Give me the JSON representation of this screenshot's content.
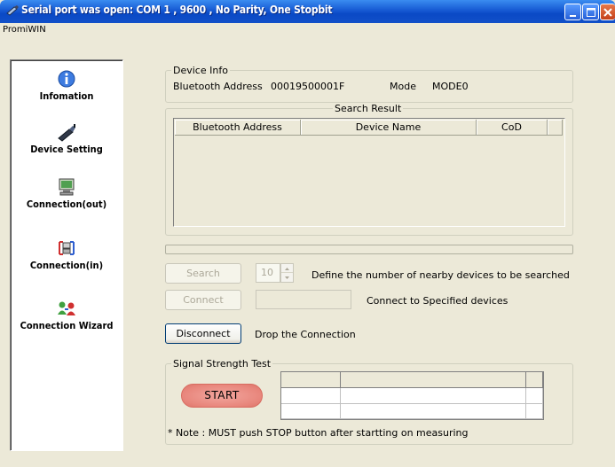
{
  "window": {
    "title": "Serial port was open: COM 1 , 9600 , No Parity, One Stopbit",
    "app_name": "PromiWIN"
  },
  "sidebar": {
    "items": [
      {
        "label": "Infomation",
        "icon": "info-icon"
      },
      {
        "label": "Device Setting",
        "icon": "device-setting-icon"
      },
      {
        "label": "Connection(out)",
        "icon": "connection-out-icon"
      },
      {
        "label": "Connection(in)",
        "icon": "connection-in-icon"
      },
      {
        "label": "Connection Wizard",
        "icon": "connection-wizard-icon"
      }
    ]
  },
  "device_info": {
    "title": "Device Info",
    "bt_address_label": "Bluetooth Address",
    "bt_address_value": "00019500001F",
    "mode_label": "Mode",
    "mode_value": "MODE0"
  },
  "search_result": {
    "title": "Search Result",
    "columns": [
      "Bluetooth Address",
      "Device Name",
      "CoD"
    ]
  },
  "search": {
    "button_label": "Search",
    "count_value": "10",
    "description": "Define the number of nearby devices to be searched"
  },
  "connect": {
    "button_label": "Connect",
    "description": "Connect to Specified devices"
  },
  "disconnect": {
    "button_label": "Disconnect",
    "description": "Drop the Connection"
  },
  "signal_test": {
    "title": "Signal Strength Test",
    "start_label": "START",
    "note": "* Note : MUST push STOP button after startting on measuring"
  },
  "colors": {
    "titlebar": "#0a49c6",
    "window_bg": "#ece9d8",
    "start_button": "#e8867c"
  }
}
